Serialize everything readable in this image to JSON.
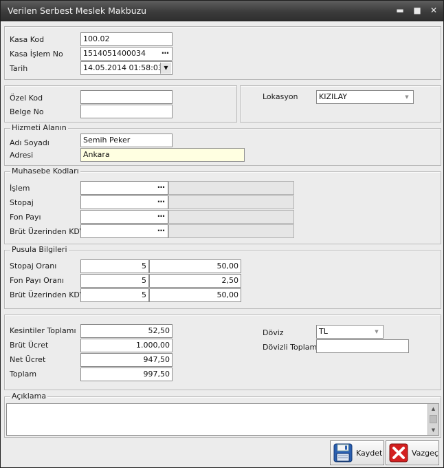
{
  "window": {
    "title": "Verilen Serbest Meslek Makbuzu",
    "minimize_glyph": "▬",
    "maximize_glyph": "■",
    "close_glyph": "✕"
  },
  "kasa": {
    "kasa_kod_label": "Kasa Kod",
    "kasa_kod_value": "100.02",
    "kasa_islem_no_label": "Kasa İşlem No",
    "kasa_islem_no_value": "1514051400034",
    "tarih_label": "Tarih",
    "tarih_value": "14.05.2014 01:58:03"
  },
  "kod": {
    "ozel_kod_label": "Özel Kod",
    "ozel_kod_value": "",
    "belge_no_label": "Belge No",
    "belge_no_value": ""
  },
  "lokasyon": {
    "label": "Lokasyon",
    "value": "KIZILAY"
  },
  "hizmeti_alanin": {
    "legend": "Hizmeti Alanın",
    "adi_soyadi_label": "Adı Soyadı",
    "adi_soyadi_value": "Semih Peker",
    "adresi_label": "Adresi",
    "adresi_value": "Ankara"
  },
  "muhasebe": {
    "legend": "Muhasebe Kodları",
    "rows": [
      {
        "label": "İşlem",
        "code": "",
        "description": ""
      },
      {
        "label": "Stopaj",
        "code": "",
        "description": ""
      },
      {
        "label": "Fon Payı",
        "code": "",
        "description": ""
      },
      {
        "label": "Brüt Üzerinden KDV",
        "code": "",
        "description": ""
      }
    ]
  },
  "pusula": {
    "legend": "Pusula Bilgileri",
    "rows": [
      {
        "label": "Stopaj Oranı",
        "rate": "5",
        "amount": "50,00"
      },
      {
        "label": "Fon Payı Oranı",
        "rate": "5",
        "amount": "2,50"
      },
      {
        "label": "Brüt Üzerinden KDV",
        "rate": "5",
        "amount": "50,00"
      }
    ]
  },
  "totals": {
    "kesintiler_toplami_label": "Kesintiler Toplamı",
    "kesintiler_toplami_value": "52,50",
    "brut_ucret_label": "Brüt Ücret",
    "brut_ucret_value": "1.000,00",
    "net_ucret_label": "Net Ücret",
    "net_ucret_value": "947,50",
    "toplam_label": "Toplam",
    "toplam_value": "997,50"
  },
  "doviz": {
    "doviz_label": "Döviz",
    "doviz_value": "TL",
    "dovizli_toplam_label": "Dövizli Toplam",
    "dovizli_toplam_value": ""
  },
  "aciklama": {
    "legend": "Açıklama",
    "value": ""
  },
  "buttons": {
    "save_label": "Kaydet",
    "cancel_label": "Vazgeç"
  },
  "icons": {
    "browse": "ellipsis-icon",
    "dropdown": "chevron-down-icon",
    "save": "floppy-disk-icon",
    "cancel": "red-x-icon"
  },
  "colors": {
    "titlebar": "#3c3c3c",
    "active_input": "#ffffe1",
    "cancel_red": "#d32020",
    "save_blue": "#2a5fb0"
  }
}
